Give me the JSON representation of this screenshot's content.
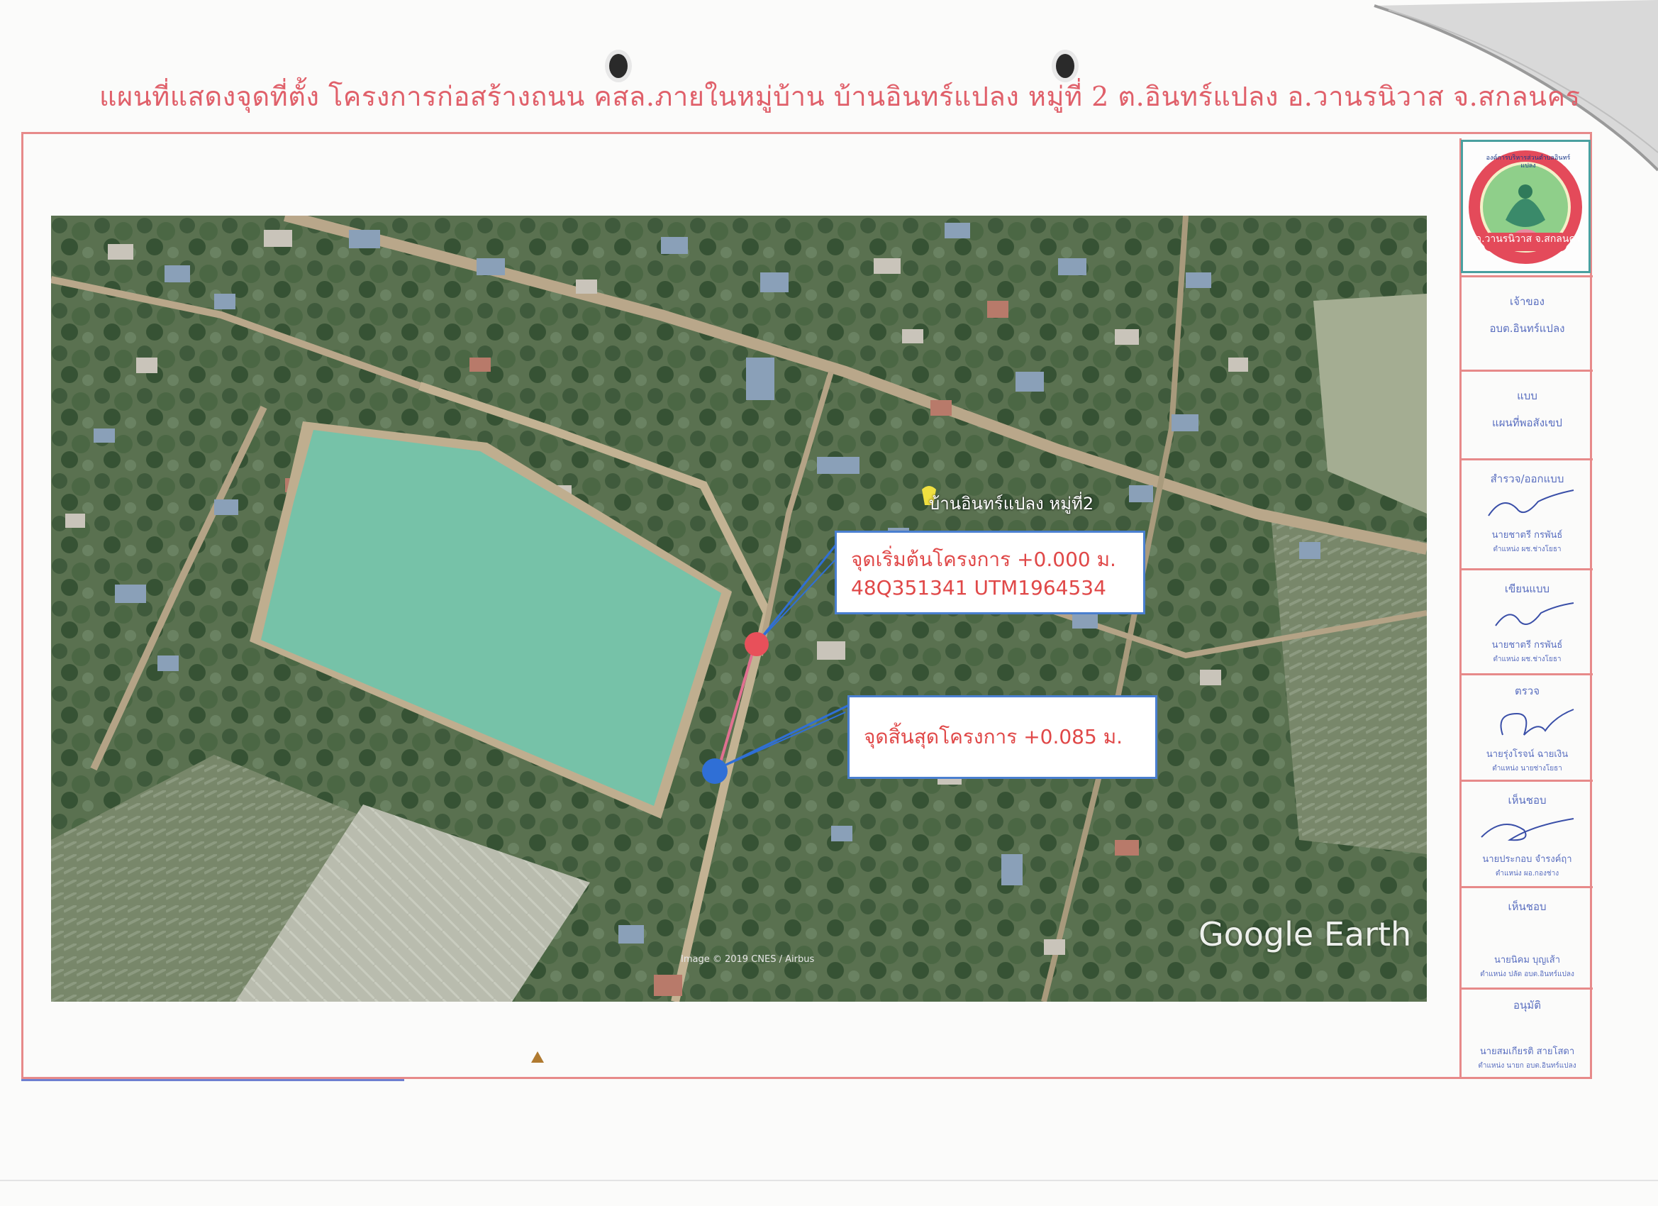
{
  "title": "แผนที่แสดงจุดที่ตั้ง โครงการก่อสร้างถนน คสล.ภายในหมู่บ้าน  บ้านอินทร์แปลง หมู่ที่ 2 ต.อินทร์แปลง อ.วานรนิวาส จ.สกลนคร",
  "map": {
    "place_label": "บ้านอินทร์แปลง หมู่ที่2",
    "start_point": {
      "label": "จุดเริ่มต้นโครงการ +0.000 ม.",
      "coordinate": "48Q351341 UTM1964534",
      "color": "#e8505a"
    },
    "end_point": {
      "label": "จุดสิ้นสุดโครงการ +0.085 ม.",
      "color": "#2f6fd6"
    },
    "road_color": "#e07090",
    "watermark": "Google Earth",
    "imagery_credit": "Image © 2019 CNES / Airbus"
  },
  "sidebar": {
    "logo": {
      "text_top": "องค์การบริหารส่วนตำบลอินทร์แปลง",
      "text_bottom": "อ.วานรนิวาส จ.สกลนคร"
    },
    "owner": {
      "header": "เจ้าของ",
      "value": "อบต.อินทร์แปลง"
    },
    "type": {
      "header": "แบบ",
      "value": "แผนที่พอสังเขป"
    },
    "survey": {
      "header": "สำรวจ/ออกแบบ",
      "name": "นายชาตรี  กรพันธ์",
      "position": "ตำแหน่ง ผช.ช่างโยธา"
    },
    "drawn": {
      "header": "เขียนแบบ",
      "name": "นายชาตรี  กรพันธ์",
      "position": "ตำแหน่ง ผช.ช่างโยธา"
    },
    "checked": {
      "header": "ตรวจ",
      "name": "นายรุ่งโรจน์  ฉายเงิน",
      "position": "ตำแหน่ง นายช่างโยธา"
    },
    "agree1": {
      "header": "เห็นชอบ",
      "name": "นายประกอบ จำรงค์ฤา",
      "position": "ตำแหน่ง ผอ.กองช่าง"
    },
    "agree2": {
      "header": "เห็นชอบ",
      "name": "นายนิคม  บุญเส้า",
      "position": "ตำแหน่ง ปลัด อบต.อินทร์แปลง"
    },
    "approve": {
      "header": "อนุมัติ",
      "name": "นายสมเกียรติ  สายโสดา",
      "position": "ตำแหน่ง นายก อบต.อินทร์แปลง"
    }
  }
}
